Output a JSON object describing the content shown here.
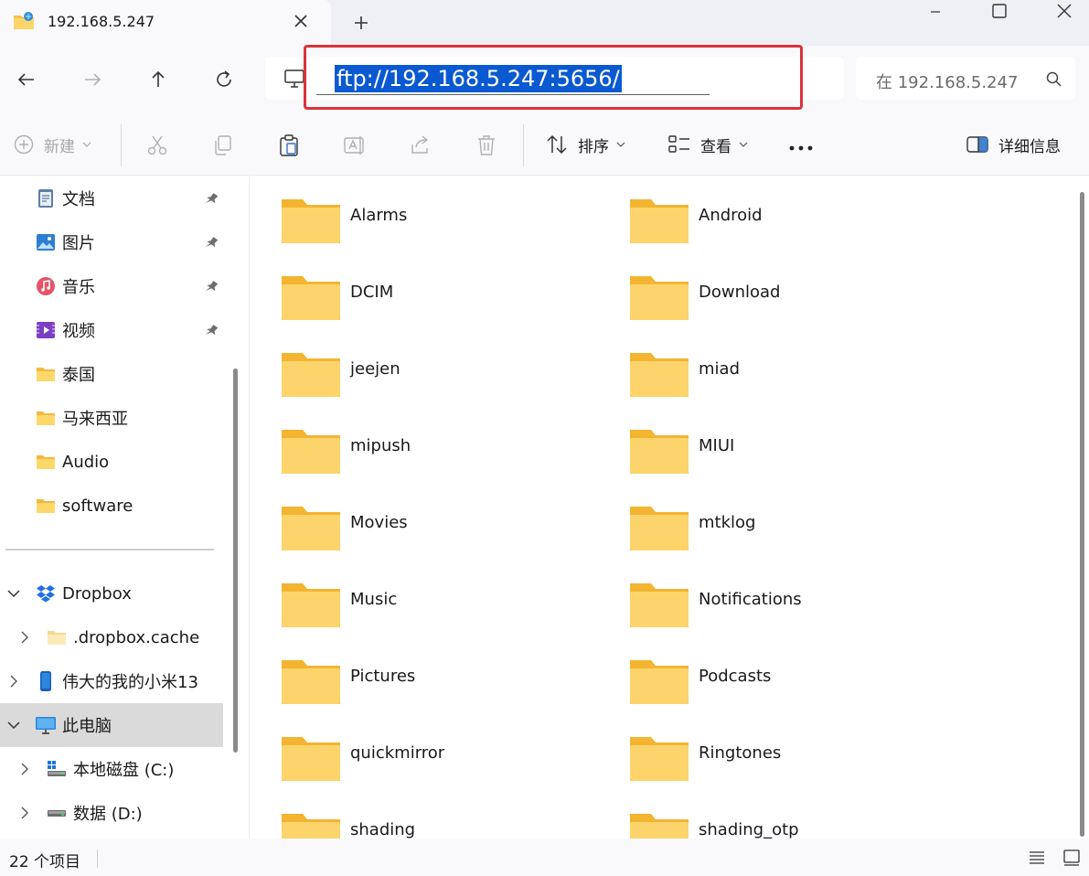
{
  "tab": {
    "title": "192.168.5.247"
  },
  "address": {
    "value": "ftp://192.168.5.247:5656/"
  },
  "search": {
    "placeholder": "在 192.168.5.247"
  },
  "toolbar": {
    "new_label": "新建",
    "sort_label": "排序",
    "view_label": "查看",
    "details_label": "详细信息"
  },
  "sidebar": {
    "quick_access": [
      {
        "label": "文档",
        "icon": "document-icon",
        "pinned": true
      },
      {
        "label": "图片",
        "icon": "pictures-icon",
        "pinned": true
      },
      {
        "label": "音乐",
        "icon": "music-icon",
        "pinned": true
      },
      {
        "label": "视频",
        "icon": "video-icon",
        "pinned": true
      },
      {
        "label": "泰国",
        "icon": "folder-icon",
        "pinned": false
      },
      {
        "label": "马来西亚",
        "icon": "folder-icon",
        "pinned": false
      },
      {
        "label": "Audio",
        "icon": "folder-icon",
        "pinned": false
      },
      {
        "label": "software",
        "icon": "folder-icon",
        "pinned": false
      }
    ],
    "tree": [
      {
        "label": "Dropbox",
        "icon": "dropbox-icon",
        "expanded": true
      },
      {
        "label": ".dropbox.cache",
        "icon": "folder-light-icon",
        "expanded": false
      },
      {
        "label": "伟大的我的小米13",
        "icon": "phone-icon",
        "expanded": false
      },
      {
        "label": "此电脑",
        "icon": "computer-icon",
        "expanded": true,
        "selected": true
      },
      {
        "label": "本地磁盘 (C:)",
        "icon": "windows-drive-icon",
        "expanded": false
      },
      {
        "label": "数据 (D:)",
        "icon": "drive-icon",
        "expanded": false
      }
    ]
  },
  "folders": [
    "Alarms",
    "Android",
    "DCIM",
    "Download",
    "jeejen",
    "miad",
    "mipush",
    "MIUI",
    "Movies",
    "mtklog",
    "Music",
    "Notifications",
    "Pictures",
    "Podcasts",
    "quickmirror",
    "Ringtones",
    "shading",
    "shading_otp"
  ],
  "status": {
    "item_count": "22 个项目"
  },
  "colors": {
    "accent": "#0a59d1",
    "highlight_box": "#d9343a",
    "folder": "#f8c84a"
  }
}
